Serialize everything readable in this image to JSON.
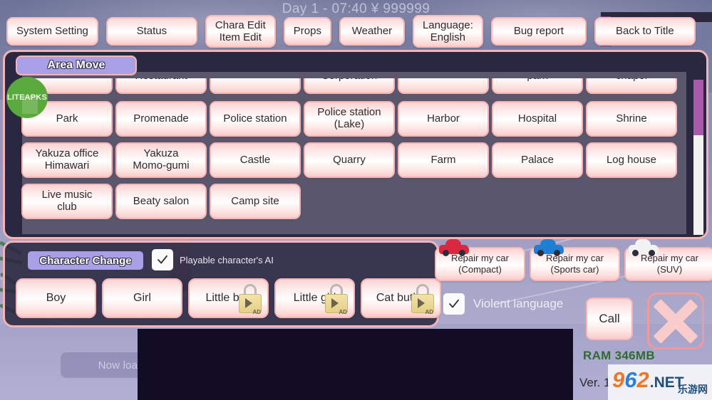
{
  "hud": {
    "status_line": "Day 1 - 07:40  ¥ 999999",
    "ram": "RAM 346MB",
    "version": "Ver. 1",
    "now_loading": "Now loading"
  },
  "colors": {
    "button_border": "#f5b5b7",
    "button_face": "#ffffff",
    "panel_bg": "#2a2740",
    "title_chip": "#a7a0e6",
    "scrollbar_top": "#a85aa8",
    "scrollbar_thumb": "#f2f2f2",
    "ram_text": "#2f6b33",
    "close_x": "#f9cbcb",
    "watermark_green": "#59a93c"
  },
  "top_menu": {
    "items": [
      {
        "label": "System Setting",
        "two_line": false
      },
      {
        "label": "Status",
        "two_line": false
      },
      {
        "label": "Chara Edit\nItem Edit",
        "two_line": true
      },
      {
        "label": "Props",
        "two_line": false
      },
      {
        "label": "Weather",
        "two_line": false
      },
      {
        "label": "Language:\nEnglish",
        "two_line": true
      },
      {
        "label": "Bug report",
        "two_line": false
      },
      {
        "label": "Back to Title",
        "two_line": false
      }
    ]
  },
  "area_move": {
    "title": "Area Move",
    "scroll_position_pct": 36,
    "clipped_row": [
      {
        "label": ""
      },
      {
        "label": "Restaurant"
      },
      {
        "label": ""
      },
      {
        "label": "Corporation"
      },
      {
        "label": ""
      },
      {
        "label": "park"
      },
      {
        "label": "chapel"
      }
    ],
    "buttons": [
      {
        "label": "Park"
      },
      {
        "label": "Promenade"
      },
      {
        "label": "Police station"
      },
      {
        "label": "Police station\n(Lake)"
      },
      {
        "label": "Harbor"
      },
      {
        "label": "Hospital"
      },
      {
        "label": "Shrine"
      },
      {
        "label": "Yakuza office\nHimawari"
      },
      {
        "label": "Yakuza\nMomo-gumi"
      },
      {
        "label": "Castle"
      },
      {
        "label": "Quarry"
      },
      {
        "label": "Farm"
      },
      {
        "label": "Palace"
      },
      {
        "label": "Log house"
      },
      {
        "label": "Live music\nclub"
      },
      {
        "label": "Beaty salon"
      },
      {
        "label": "Camp site"
      }
    ]
  },
  "character_change": {
    "title": "Character Change",
    "ai_checkbox": {
      "label": "Playable character's AI",
      "checked": true
    },
    "buttons": [
      {
        "label": "Boy",
        "locked": false
      },
      {
        "label": "Girl",
        "locked": false
      },
      {
        "label": "Little boy",
        "locked": true,
        "lock_tag": "AD"
      },
      {
        "label": "Little girl",
        "locked": true,
        "lock_tag": "AD"
      },
      {
        "label": "Cat butler",
        "locked": true,
        "lock_tag": "AD"
      }
    ]
  },
  "vehicle": {
    "buttons": [
      {
        "label": "Repair my car\n(Compact)",
        "icon": "car-red-icon",
        "color": "#d9283f"
      },
      {
        "label": "Repair my car\n(Sports car)",
        "icon": "car-blue-icon",
        "color": "#1f7fd4"
      },
      {
        "label": "Repair my car\n(SUV)",
        "icon": "car-white-icon",
        "color": "#f2f2f2"
      }
    ]
  },
  "misc": {
    "violent_checkbox": {
      "label": "Violent language",
      "checked": true
    },
    "call_button": "Call",
    "close_button": "close-icon"
  },
  "watermarks": {
    "liteapks": "LITEAPKS",
    "cn_site": {
      "n9": "9",
      "n6": "6",
      "n2": "2",
      "net": ".NET",
      "cn": "乐游网"
    }
  }
}
